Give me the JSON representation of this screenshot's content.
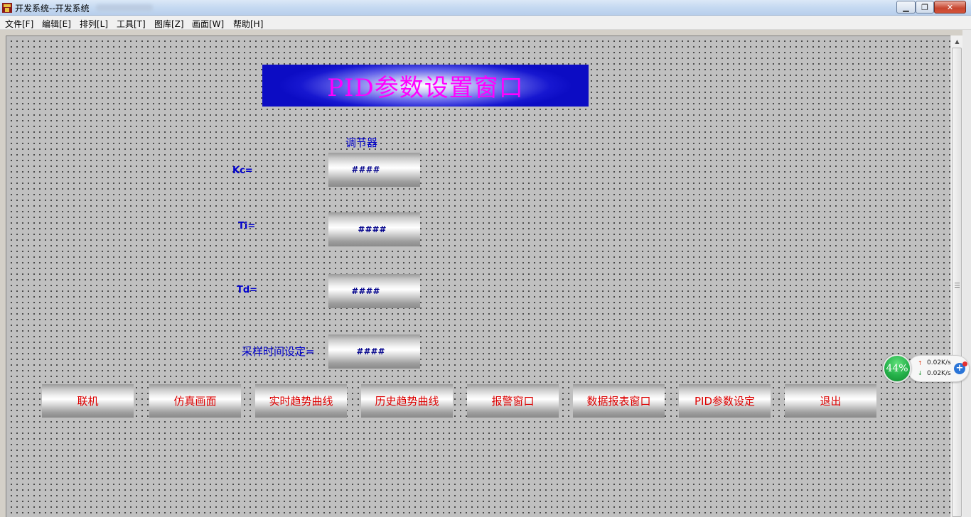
{
  "window": {
    "title": "开发系统--开发系统"
  },
  "menu": [
    {
      "label": "文件[F]"
    },
    {
      "label": "编辑[E]"
    },
    {
      "label": "排列[L]"
    },
    {
      "label": "工具[T]"
    },
    {
      "label": "图库[Z]"
    },
    {
      "label": "画面[W]"
    },
    {
      "label": "帮助[H]"
    }
  ],
  "screen": {
    "banner_title": "PID参数设置窗口",
    "section_label": "调节器",
    "params": [
      {
        "label": "Kc=",
        "value": "####"
      },
      {
        "label": "Ti=",
        "value": "####"
      },
      {
        "label": "Td=",
        "value": "####"
      },
      {
        "label": "采样时间设定=",
        "value": "####"
      }
    ],
    "nav_buttons": [
      {
        "label": "联机"
      },
      {
        "label": "仿真画面"
      },
      {
        "label": "实时趋势曲线"
      },
      {
        "label": "历史趋势曲线"
      },
      {
        "label": "报警窗口"
      },
      {
        "label": "数据报表窗口"
      },
      {
        "label": "PID参数设定"
      },
      {
        "label": "退出"
      }
    ]
  },
  "net_widget": {
    "percent": "44%",
    "upload": "0.02K/s",
    "download": "0.02K/s"
  },
  "colors": {
    "banner_text": "#ff00ff",
    "label_text": "#0000cc",
    "nav_text": "#dd0000",
    "canvas_bg": "#c0c0c0"
  }
}
